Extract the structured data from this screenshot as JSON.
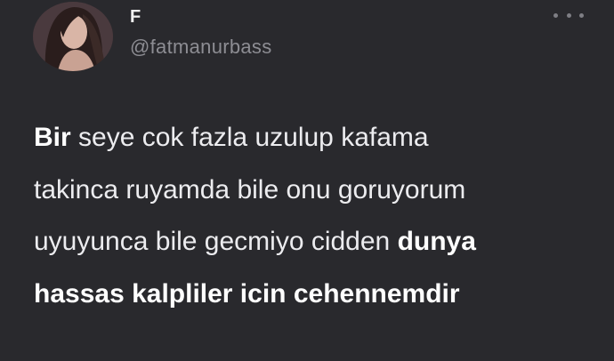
{
  "author": {
    "display_name": "F",
    "handle": "@fatmanurbass"
  },
  "menu": {
    "icon": "more-horizontal-icon"
  },
  "tweet": {
    "l1_bold": "Bir",
    "l1_rest": " seye cok fazla uzulup kafama",
    "l2": "takinca ruyamda bile onu goruyorum",
    "l3_rest": "uyuyunca bile gecmiyo cidden ",
    "l3_bold": "dunya",
    "l4_bold": "hassas kalpliler icin cehennemdir"
  },
  "colors": {
    "background": "#29292d",
    "text": "#ececef",
    "muted": "#8d8d93"
  }
}
